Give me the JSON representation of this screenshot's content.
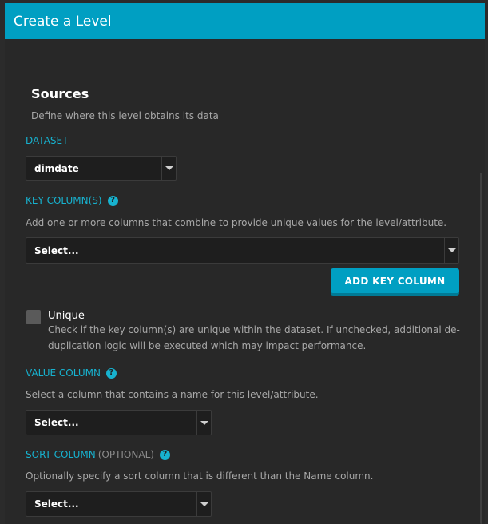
{
  "dialog": {
    "title": "Create a Level"
  },
  "sources": {
    "title": "Sources",
    "description": "Define where this level obtains its data"
  },
  "dataset": {
    "label": "DATASET",
    "selected": "dimdate"
  },
  "key_columns": {
    "label": "KEY COLUMN(S)",
    "help_icon": "?",
    "description": "Add one or more columns that combine to provide unique values for the level/attribute.",
    "selected": "Select...",
    "add_button": "ADD KEY COLUMN"
  },
  "unique": {
    "label": "Unique",
    "checked": false,
    "description_line1": "Check if the key column(s) are unique within the dataset. If unchecked, additional de-",
    "description_line2": "duplication logic will be executed which may impact performance."
  },
  "value_column": {
    "label": "VALUE COLUMN",
    "help_icon": "?",
    "description": "Select a column that contains a name for this level/attribute.",
    "selected": "Select..."
  },
  "sort_column": {
    "label": "SORT COLUMN",
    "optional": "(OPTIONAL)",
    "help_icon": "?",
    "description": "Optionally specify a sort column that is different than the Name column.",
    "selected": "Select..."
  },
  "colors": {
    "accent": "#009fc2",
    "label": "#17b2cf",
    "background": "#282828",
    "input": "#1e1e1e"
  }
}
